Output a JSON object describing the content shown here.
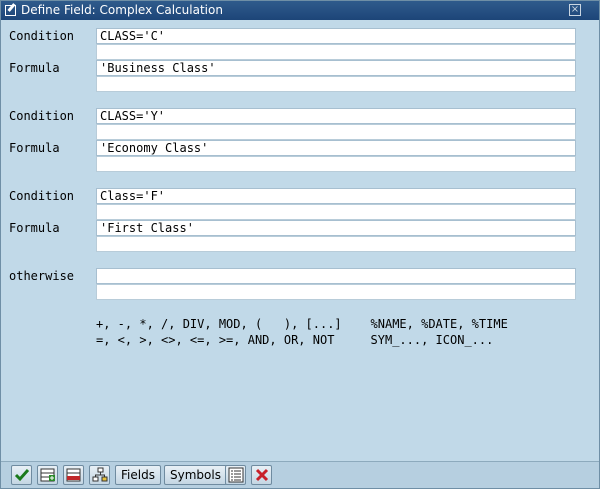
{
  "window": {
    "title": "Define Field: Complex Calculation",
    "close_glyph": "×"
  },
  "blocks": [
    {
      "condition_label": "Condition",
      "condition": "CLASS='C'",
      "formula_label": "Formula",
      "formula": "'Business Class'"
    },
    {
      "condition_label": "Condition",
      "condition": "CLASS='Y'",
      "formula_label": "Formula",
      "formula": "'Economy Class'"
    },
    {
      "condition_label": "Condition",
      "condition": "Class='F'",
      "formula_label": "Formula",
      "formula": "'First Class'"
    }
  ],
  "otherwise": {
    "label": "otherwise",
    "value": ""
  },
  "help": {
    "line1": "+, -, *, /, DIV, MOD, (   ), [...]    %NAME, %DATE, %TIME",
    "line2": "=, <, >, <>, <=, >=, AND, OR, NOT     SYM_..., ICON_..."
  },
  "toolbar": {
    "fields_label": "Fields",
    "symbols_label": "Symbols",
    "icons": [
      "check-icon",
      "insert-line-icon",
      "delete-line-icon",
      "hierarchy-icon",
      "list-icon",
      "cancel-icon"
    ]
  }
}
